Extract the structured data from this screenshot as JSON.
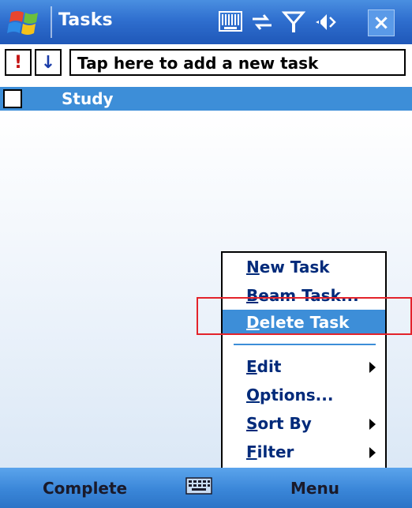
{
  "titlebar": {
    "title": "Tasks",
    "icons": [
      "start-windows-icon",
      "barcode-icon",
      "connectivity-icon",
      "signal-antenna-icon",
      "speaker-icon",
      "close-icon"
    ],
    "close_label": "×"
  },
  "new_task": {
    "priority_high_label": "!",
    "priority_low_label": "↓",
    "placeholder": "Tap here to add a new task"
  },
  "tasks": [
    {
      "label": "Study",
      "completed": false,
      "selected": true
    }
  ],
  "context_menu": {
    "items": [
      {
        "label": "New Task",
        "access_key": "N",
        "rest": "ew Task",
        "submenu": false
      },
      {
        "label": "Beam Task...",
        "access_key": "B",
        "rest": "eam Task...",
        "submenu": false
      },
      {
        "label": "Delete Task",
        "access_key": "D",
        "rest": "elete Task",
        "submenu": false,
        "selected": true
      },
      {
        "label": "Edit",
        "access_key": "E",
        "rest": "dit",
        "submenu": true
      },
      {
        "label": "Options...",
        "access_key": "O",
        "rest": "ptions...",
        "submenu": false
      },
      {
        "label": "Sort By",
        "access_key": "S",
        "rest": "ort By",
        "submenu": true
      },
      {
        "label": "Filter",
        "access_key": "F",
        "rest": "ilter",
        "submenu": true
      }
    ]
  },
  "softkeys": {
    "left": "Complete",
    "right": "Menu",
    "input_icon": "keyboard-icon"
  },
  "colors": {
    "titlebar": "#2f6fcf",
    "selection": "#3d8ed8",
    "annotation": "#e3232b",
    "menu_text": "#002a7a"
  }
}
